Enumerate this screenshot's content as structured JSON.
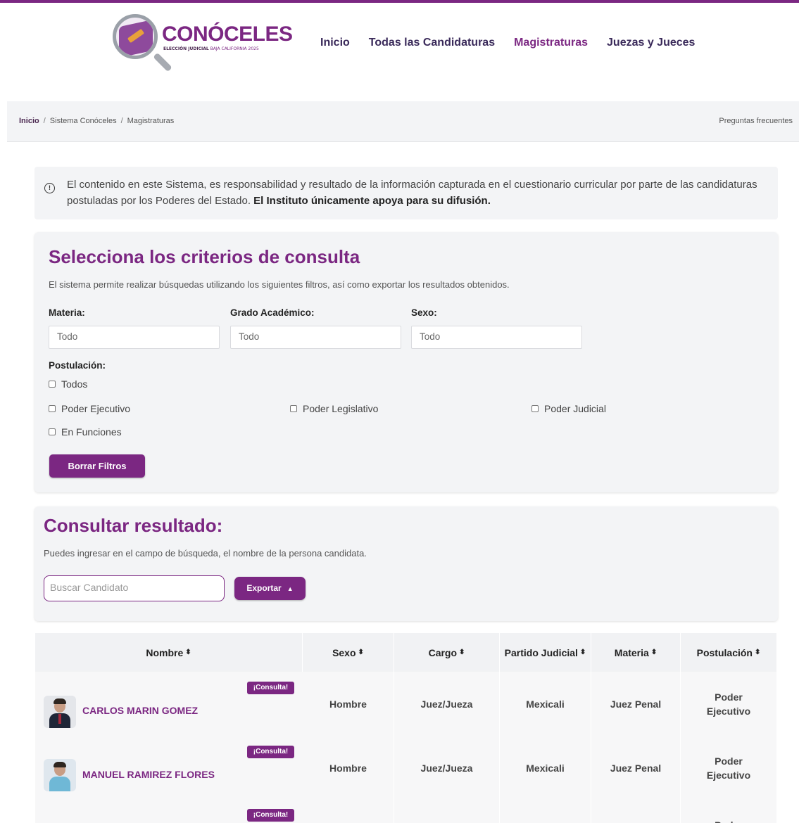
{
  "brand": {
    "title": "CONÓCELES",
    "subtitle_bold": "ELECCIÓN JUDICIAL",
    "subtitle_rest": " BAJA CALIFORNIA 2025",
    "accent": "#7b2782"
  },
  "nav": [
    {
      "label": "Inicio",
      "active": false
    },
    {
      "label": "Todas las Candidaturas",
      "active": false
    },
    {
      "label": "Magistraturas",
      "active": true
    },
    {
      "label": "Juezas y Jueces",
      "active": false
    }
  ],
  "breadcrumb": {
    "home": "Inicio",
    "sep": "/",
    "level1": "Sistema Conóceles",
    "level2": "Magistraturas",
    "faq": "Preguntas frecuentes"
  },
  "notice": {
    "icon": "info-icon",
    "text": "El contenido en este Sistema, es responsabilidad y resultado de la información capturada en el cuestionario curricular por parte de las candidaturas postuladas por los Poderes del Estado. ",
    "bold": "El Instituto únicamente apoya para su difusión."
  },
  "filters": {
    "title": "Selecciona los criterios de consulta",
    "description": "El sistema permite realizar búsquedas utilizando los siguientes filtros, así como exportar los resultados obtenidos.",
    "materia": {
      "label": "Materia:",
      "value": "Todo"
    },
    "grado": {
      "label": "Grado Académico:",
      "value": "Todo"
    },
    "sexo": {
      "label": "Sexo:",
      "value": "Todo"
    },
    "postulacion_label": "Postulación:",
    "options": {
      "todos": "Todos",
      "ejecutivo": "Poder Ejecutivo",
      "legislativo": "Poder Legislativo",
      "judicial": "Poder Judicial",
      "funciones": "En Funciones"
    },
    "clear_button": "Borrar Filtros"
  },
  "results": {
    "title": "Consultar resultado:",
    "description": "Puedes ingresar en el campo de búsqueda, el nombre de la persona candidata.",
    "search_placeholder": "Buscar Candidato",
    "export_button": "Exportar",
    "export_arrow": "▲"
  },
  "table": {
    "headers": [
      "Nombre",
      "Sexo",
      "Cargo",
      "Partido Judicial",
      "Materia",
      "Postulación"
    ],
    "sort_icon": "⬍",
    "badge": "¡Consulta!",
    "rows": [
      {
        "nombre": "CARLOS MARIN GOMEZ",
        "sexo": "Hombre",
        "cargo": "Juez/Jueza",
        "partido": "Mexicali",
        "materia": "Juez Penal",
        "postulacion_1": "Poder",
        "postulacion_2": "Ejecutivo"
      },
      {
        "nombre": "MANUEL RAMIREZ FLORES",
        "sexo": "Hombre",
        "cargo": "Juez/Jueza",
        "partido": "Mexicali",
        "materia": "Juez Penal",
        "postulacion_1": "Poder",
        "postulacion_2": "Ejecutivo"
      },
      {
        "nombre": "",
        "sexo": "",
        "cargo": "",
        "partido": "",
        "materia": "",
        "postulacion_1": "Poder",
        "postulacion_2": ""
      }
    ]
  }
}
